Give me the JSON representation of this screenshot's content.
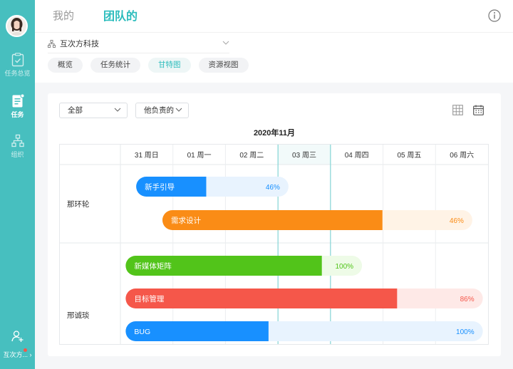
{
  "sidebar": {
    "items": [
      {
        "label": "任务总览",
        "icon": "clipboard-check-icon"
      },
      {
        "label": "任务",
        "icon": "task-list-icon",
        "active": true
      },
      {
        "label": "组织",
        "icon": "org-chart-icon"
      }
    ],
    "add_member_icon": "add-user-icon",
    "org_switch_label": "互次方..."
  },
  "header": {
    "tabs": [
      {
        "label": "我的",
        "active": false
      },
      {
        "label": "团队的",
        "active": true
      }
    ]
  },
  "company": {
    "name": "互次方科技"
  },
  "view_tabs": [
    {
      "label": "概览",
      "active": false
    },
    {
      "label": "任务统计",
      "active": false
    },
    {
      "label": "甘特图",
      "active": true
    },
    {
      "label": "资源视图",
      "active": false
    }
  ],
  "filters": {
    "scope": "全部",
    "role": "他负责的"
  },
  "gantt": {
    "month_title": "2020年11月",
    "days": [
      "31 周日",
      "01 周一",
      "02 周二",
      "03 周三",
      "04 周四",
      "05 周五",
      "06 周六"
    ],
    "today_index": 3,
    "groups": [
      {
        "assignee": "那环轮",
        "tasks": [
          {
            "name": "新手引导",
            "percent_label": "46%",
            "progress": 0.46,
            "start_day": 0.3,
            "end_day": 3.2,
            "color": "#1890ff",
            "track": "#e8f3fe",
            "label_color": "#1890ff"
          },
          {
            "name": "需求设计",
            "percent_label": "46%",
            "progress": 0.71,
            "start_day": 0.8,
            "end_day": 6.7,
            "color": "#fa8c16",
            "track": "#fff3e6",
            "label_color": "#fa8c16"
          }
        ]
      },
      {
        "assignee": "邢诚琰",
        "tasks": [
          {
            "name": "新媒体矩阵",
            "percent_label": "100%",
            "progress": 0.83,
            "start_day": 0.1,
            "end_day": 4.6,
            "color": "#52c41a",
            "track": "#eefbe7",
            "label_color": "#52c41a"
          },
          {
            "name": "目标管理",
            "percent_label": "86%",
            "progress": 0.76,
            "start_day": 0.1,
            "end_day": 6.9,
            "color": "#f5574a",
            "track": "#fee9e7",
            "label_color": "#f5574a"
          },
          {
            "name": "BUG",
            "percent_label": "100%",
            "progress": 0.4,
            "start_day": 0.1,
            "end_day": 6.9,
            "color": "#1890ff",
            "track": "#e8f3fe",
            "label_color": "#1890ff"
          }
        ]
      }
    ]
  }
}
